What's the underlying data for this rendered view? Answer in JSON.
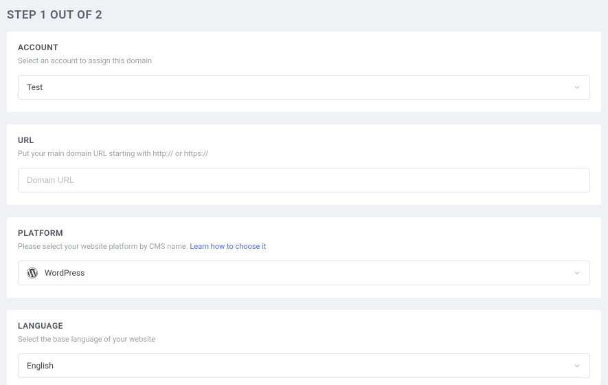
{
  "page": {
    "title": "STEP 1 OUT OF 2"
  },
  "account": {
    "label": "ACCOUNT",
    "description": "Select an account to assign this domain",
    "value": "Test"
  },
  "url": {
    "label": "URL",
    "description": "Put your main domain URL starting with http:// or https://",
    "placeholder": "Domain URL"
  },
  "platform": {
    "label": "PLATFORM",
    "description_prefix": "Please select your website platform by CMS name.  ",
    "link_text": "Learn how to choose it",
    "value": "WordPress"
  },
  "language": {
    "label": "LANGUAGE",
    "description": "Select the base language of your website",
    "value": "English"
  }
}
